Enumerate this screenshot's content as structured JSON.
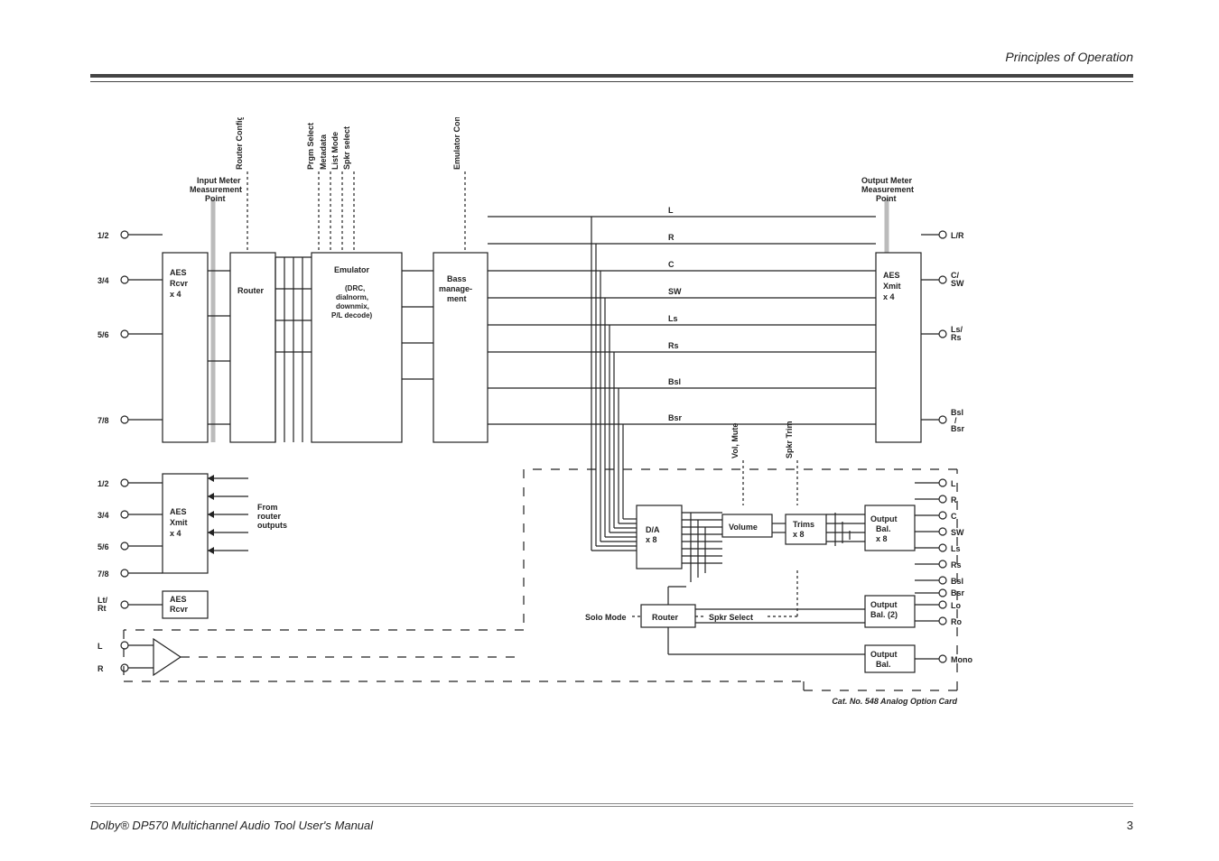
{
  "header": {
    "title": "Principles of Operation"
  },
  "footer": {
    "text": "Dolby® DP570 Multichannel Audio Tool User's Manual",
    "page": "3"
  },
  "labels": {
    "input_meter": "Input Meter Measurement Point",
    "output_meter": "Output Meter Measurement Point",
    "router_config": "Router Config",
    "prgm_select": "Prgm Select",
    "metadata": "Metadata",
    "list_mode": "List Mode",
    "spkr_select_top": "Spkr select",
    "emulator_config": "Emulator Config",
    "vol_mute": "Vol, Mute",
    "spkr_trim": "Spkr Trim"
  },
  "blocks": {
    "aes_rcvr": "AES Rcvr x 4",
    "aes_rcvr2": "AES Rcvr",
    "router1": "Router",
    "emulator": "Emulator",
    "emulator_sub": "(DRC, dialnorm, downmix, P/L decode)",
    "bass": "Bass management",
    "aes_xmit_top": "AES Xmit x 4",
    "aes_xmit_left": "AES Xmit x 4",
    "from_router": "From router outputs",
    "da8": "D/A x 8",
    "volume": "Volume",
    "trims": "Trims x 8",
    "outbal8": "Output Bal. x 8",
    "router2": "Router",
    "outbal2": "Output Bal. (2)",
    "outbal1": "Output Bal.",
    "solo": "Solo Mode",
    "spkr_select": "Spkr Select"
  },
  "io": {
    "left_in": [
      "1/2",
      "3/4",
      "5/6",
      "7/8"
    ],
    "left_out": [
      "1/2",
      "3/4",
      "5/6",
      "7/8"
    ],
    "ltrt": "Lt/ Rt",
    "l": "L",
    "r": "R",
    "right_top": [
      "L/R",
      "C/ SW",
      "Ls/ Rs",
      "Bsl / Bsr"
    ],
    "right_analog": [
      "L",
      "R",
      "C",
      "SW",
      "Ls",
      "Rs",
      "Bsl",
      "Bsr"
    ],
    "right_bal2": [
      "Lo",
      "Ro"
    ],
    "right_mono": "Mono"
  },
  "channels": [
    "L",
    "R",
    "C",
    "SW",
    "Ls",
    "Rs",
    "Bsl",
    "Bsr"
  ],
  "cardnote": "Cat. No. 548 Analog Option Card"
}
